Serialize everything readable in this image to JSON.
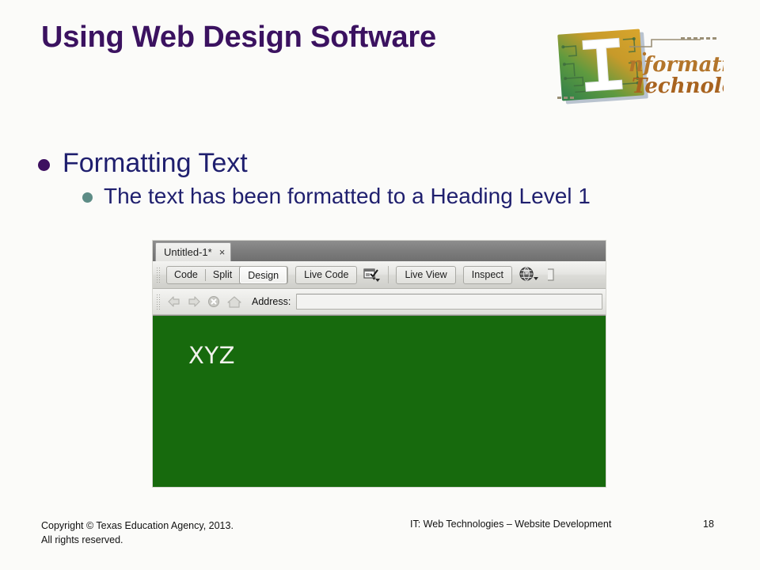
{
  "slide": {
    "title": "Using Web Design Software",
    "title_color": "#3b1260",
    "background_color": "#fbfbf9",
    "body_text_color": "#1f1f6e"
  },
  "logo": {
    "name": "information-technology-logo",
    "word_top": "nformation",
    "word_bottom": "Technology",
    "big_letter": "I"
  },
  "bullets": [
    {
      "level": 1,
      "text": "Formatting Text",
      "dot_color": "#3d1060"
    },
    {
      "level": 2,
      "text": "The text has been formatted to a Heading Level 1",
      "dot_color": "#5d8c86"
    }
  ],
  "dreamweaver": {
    "tab": {
      "label": "Untitled-1*",
      "close_label": "×"
    },
    "view_buttons": [
      {
        "label": "Code",
        "selected": false
      },
      {
        "label": "Split",
        "selected": false
      },
      {
        "label": "Design",
        "selected": true
      }
    ],
    "toolbar_buttons": [
      {
        "label": "Live Code"
      },
      {
        "label": "Live View"
      },
      {
        "label": "Inspect"
      }
    ],
    "icons": [
      "live-view-options-icon",
      "browser-globe-icon",
      "visual-aids-icon"
    ],
    "address_bar": {
      "label": "Address:",
      "value": "",
      "placeholder": "",
      "nav_icons": [
        "back-arrow-icon",
        "forward-arrow-icon",
        "stop-icon",
        "home-icon"
      ]
    },
    "canvas": {
      "heading_text": "XYZ",
      "background_color": "#176a0d",
      "text_color": "#f1f2ec"
    }
  },
  "footer": {
    "copyright_line1": "Copyright © Texas Education Agency, 2013.",
    "copyright_line2": "All rights reserved.",
    "course": "IT: Web Technologies – Website Development",
    "page_number": "18"
  }
}
